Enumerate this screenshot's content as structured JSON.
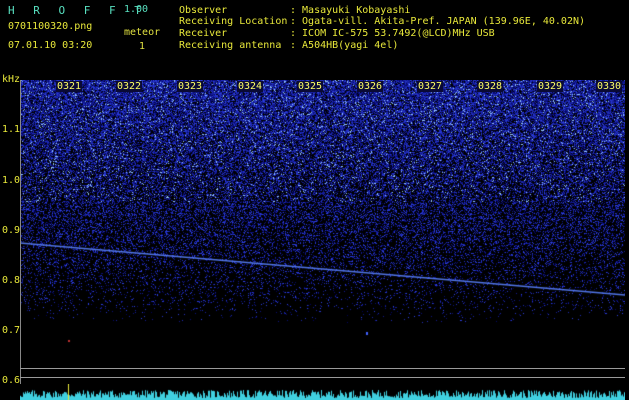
{
  "header": {
    "app_title": "H R O F F T",
    "version": "1.00",
    "filename": "0701100320.png",
    "datetime": "07.01.10 03:20",
    "meteor_label": "meteor",
    "meteor_count": "1",
    "observer_label": "Observer",
    "observer_value": ": Masayuki Kobayashi",
    "location_label": "Receiving Location",
    "location_value": ": Ogata-vill. Akita-Pref. JAPAN (139.96E, 40.02N)",
    "receiver_label": "Receiver",
    "receiver_value": ": ICOM IC-575 53.7492(@LCD)MHz USB",
    "antenna_label": "Receiving antenna",
    "antenna_value": ": A504HB(yagi 4el)"
  },
  "axes": {
    "y_unit": "kHz",
    "y_ticks": [
      "1.1",
      "1.0",
      "0.9",
      "0.8",
      "0.7",
      "0.6"
    ],
    "x_ticks": [
      "0321",
      "0322",
      "0323",
      "0324",
      "0325",
      "0326",
      "0327",
      "0328",
      "0329",
      "0330"
    ]
  },
  "colors": {
    "background": "#000000",
    "noise": "#3040d0",
    "text": "#e8e83a",
    "waveform": "#40d0e0"
  }
}
